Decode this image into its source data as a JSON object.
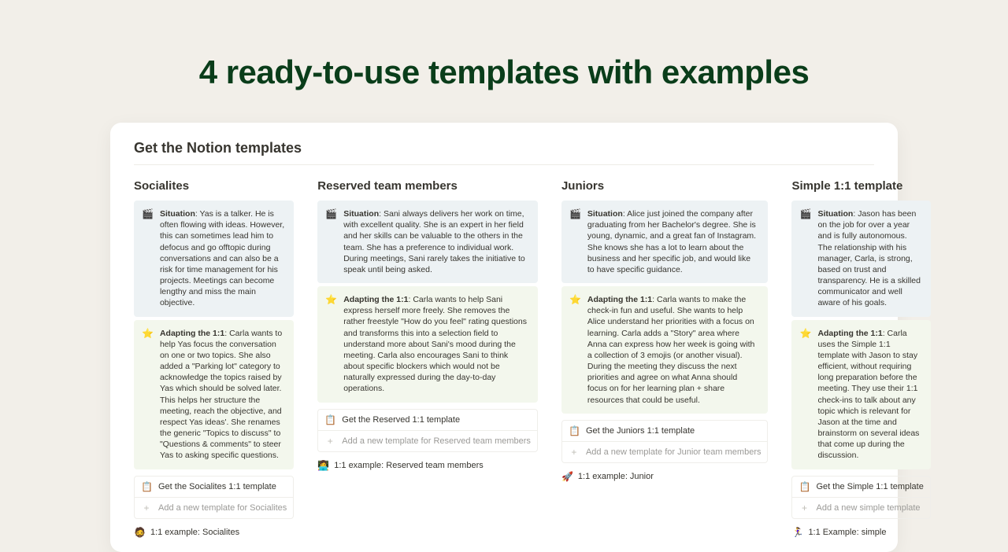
{
  "title": "4 ready-to-use templates with examples",
  "card_header": "Get the Notion templates",
  "labels": {
    "situation": "Situation",
    "adapting": "Adapting the 1:1"
  },
  "columns": [
    {
      "title": "Socialites",
      "situation_icon": "🎬",
      "situation": "Yas is a talker. He is often flowing with ideas. However, this can sometimes lead him to defocus and go offtopic during conversations and can also be a risk for time management for his projects. Meetings can become lengthy and miss the main objective.",
      "adapting_icon": "⭐",
      "adapting": "Carla wants to help Yas focus the conversation on one or two topics. She also added a \"Parking lot\" category to acknowledge the topics raised by Yas which should be solved later. This helps her structure the meeting, reach the objective, and respect Yas ideas'. She renames the generic \"Topics to discuss\" to \"Questions & comments\" to steer Yas to asking specific questions.",
      "get_icon": "📋",
      "get_label": "Get the Socialites 1:1 template",
      "add_label": "Add a new template for Socialites",
      "example_icon": "🧔",
      "example_label": "1:1 example: Socialites"
    },
    {
      "title": "Reserved team members",
      "situation_icon": "🎬",
      "situation": "Sani always delivers her work on time, with excellent quality. She is an expert in her field and her skills can be valuable to the others in the team. She has a preference to individual work. During meetings, Sani rarely takes the initiative to speak until being asked.",
      "adapting_icon": "⭐",
      "adapting": "Carla wants to help Sani express herself more freely. She removes the rather freestyle \"How do you feel\" rating questions and transforms this into a selection field to understand more about Sani's mood during the meeting. Carla also encourages Sani to think about specific blockers which would not be naturally expressed during the day-to-day operations.",
      "get_icon": "📋",
      "get_label": "Get the Reserved 1:1 template",
      "add_label": "Add a new template for Reserved team members",
      "example_icon": "👩‍💻",
      "example_label": "1:1 example: Reserved team members"
    },
    {
      "title": "Juniors",
      "situation_icon": "🎬",
      "situation": "Alice just joined the company after graduating from her Bachelor's degree. She is young, dynamic, and a great fan of Instagram. She knows she has a lot to learn about the business and her specific job, and would like to have specific guidance.",
      "adapting_icon": "⭐",
      "adapting": "Carla wants to make the check-in fun and useful. She wants to help Alice understand her priorities with a focus on learning. Carla adds a \"Story\" area where Anna can express how her week is going with a collection of 3 emojis (or another visual). During the meeting they discuss the next priorities and agree on what Anna should focus on for her learning plan + share resources that could be useful.",
      "get_icon": "📋",
      "get_label": "Get the Juniors 1:1 template",
      "add_label": "Add a new template for Junior team members",
      "example_icon": "🚀",
      "example_label": "1:1 example: Junior"
    },
    {
      "title": "Simple 1:1 template",
      "situation_icon": "🎬",
      "situation": "Jason has been on the job for over a year and is fully autonomous. The relationship with his manager, Carla, is strong, based on trust and transparency. He is a skilled communicator and well aware of his goals.",
      "adapting_icon": "⭐",
      "adapting": "Carla uses the Simple 1:1 template with Jason to stay efficient, without requiring long preparation before the meeting. They use their 1:1 check-ins to talk about any topic which is relevant for Jason at the time and brainstorm on several ideas that come up during the discussion.",
      "get_icon": "📋",
      "get_label": "Get the Simple 1:1 template",
      "add_label": "Add a new simple template",
      "example_icon": "🏃‍♀️",
      "example_label": "1:1 Example: simple"
    }
  ]
}
